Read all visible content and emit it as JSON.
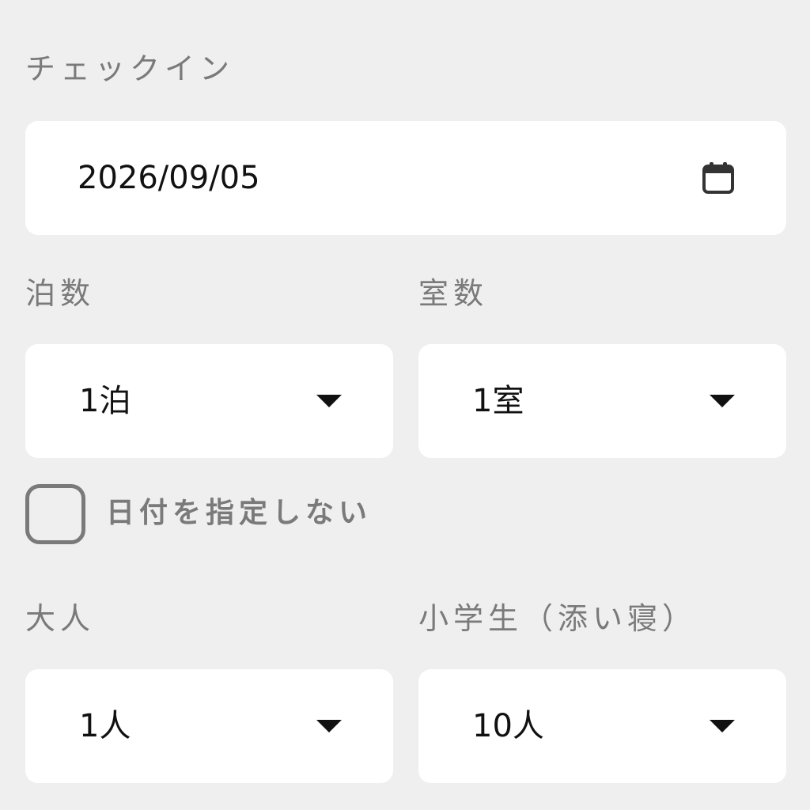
{
  "checkin": {
    "label": "チェックイン",
    "date_value": "2026/09/05",
    "icon": "calendar-icon"
  },
  "nights": {
    "label": "泊数",
    "selected": "1泊"
  },
  "rooms": {
    "label": "室数",
    "selected": "1室"
  },
  "no_date": {
    "label": "日付を指定しない",
    "checked": false
  },
  "adults": {
    "label": "大人",
    "selected": "1人"
  },
  "children": {
    "label": "小学生（添い寝）",
    "selected": "10人"
  },
  "colors": {
    "background": "#efefef",
    "field": "#ffffff",
    "label_gray": "#7a7a7a",
    "text": "#111111"
  }
}
